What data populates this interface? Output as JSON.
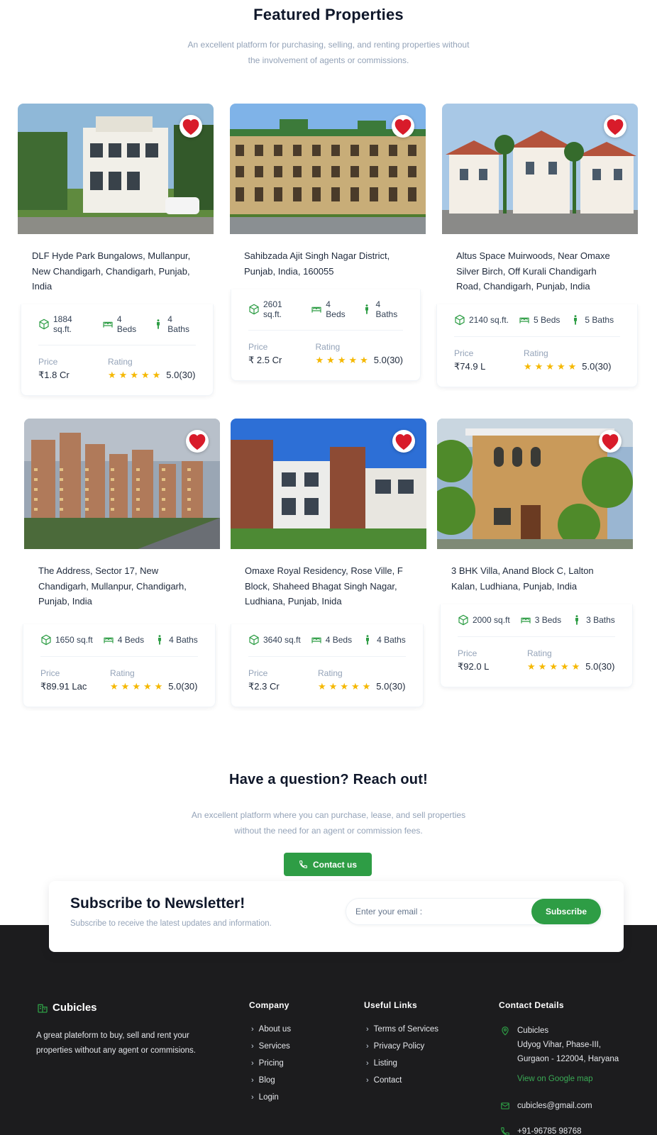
{
  "featured": {
    "title": "Featured Properties",
    "subtitle_line1": "An excellent platform for purchasing, selling, and renting properties without",
    "subtitle_line2": "the involvement of agents or commissions."
  },
  "labels": {
    "price": "Price",
    "rating": "Rating"
  },
  "properties": [
    {
      "address": "DLF Hyde Park Bungalows, Mullanpur, New Chandigarh, Chandigarh, Punjab, India",
      "area": "1884 sq.ft.",
      "beds": "4 Beds",
      "baths": "4 Baths",
      "price": "₹1.8 Cr",
      "stars": 5,
      "rating": "5.0(30)",
      "favorite": true,
      "image": "white-villa-photo"
    },
    {
      "address": "Sahibzada Ajit Singh Nagar District, Punjab, India, 160055",
      "area": "2601 sq.ft.",
      "beds": "4 Beds",
      "baths": "4 Baths",
      "price": "₹ 2.5 Cr",
      "stars": 5,
      "rating": "5.0(30)",
      "favorite": true,
      "image": "colonial-terrace-photo"
    },
    {
      "address": "Altus Space Muirwoods, Near Omaxe Silver Birch, Off Kurali Chandigarh Road, Chandigarh, Punjab, India",
      "area": "2140 sq.ft.",
      "beds": "5 Beds",
      "baths": "5 Baths",
      "price": "₹74.9 L",
      "stars": 5,
      "rating": "5.0(30)",
      "favorite": true,
      "image": "mediterranean-villas-photo"
    },
    {
      "address": "The Address, Sector 17, New Chandigarh, Mullanpur, Chandigarh, Punjab, India",
      "area": "1650 sq.ft",
      "beds": "4 Beds",
      "baths": "4 Baths",
      "price": "₹89.91 Lac",
      "stars": 5,
      "rating": "5.0(30)",
      "favorite": true,
      "image": "highrise-towers-photo"
    },
    {
      "address": "Omaxe Royal Residency, Rose Ville, F Block, Shaheed Bhagat Singh Nagar, Ludhiana, Punjab, Inida",
      "area": "3640 sq.ft",
      "beds": "4 Beds",
      "baths": "4 Baths",
      "price": "₹2.3 Cr",
      "stars": 5,
      "rating": "5.0(30)",
      "favorite": true,
      "image": "brick-floors-photo"
    },
    {
      "address": "3 BHK Villa, Anand Block C, Lalton Kalan, Ludhiana, Punjab, India",
      "area": "2000 sq.ft",
      "beds": "3 Beds",
      "baths": "3 Baths",
      "price": "₹92.0 L",
      "stars": 5,
      "rating": "5.0(30)",
      "favorite": true,
      "image": "tan-villa-photo"
    }
  ],
  "contact_section": {
    "title": "Have a question? Reach out!",
    "subtitle_line1": "An excellent platform where you can purchase, lease, and sell properties",
    "subtitle_line2": "without the need for an agent or commission fees.",
    "button": "Contact us"
  },
  "newsletter": {
    "title": "Subscribe to Newsletter!",
    "subtitle": "Subscribe to receive the latest updates and information.",
    "placeholder": "Enter your email :",
    "button": "Subscribe"
  },
  "footer": {
    "brand": "Cubicles",
    "about": "A great plateform to buy, sell and rent your properties without any agent or commisions.",
    "company": {
      "heading": "Company",
      "links": [
        "About us",
        "Services",
        "Pricing",
        "Blog",
        "Login"
      ]
    },
    "useful": {
      "heading": "Useful Links",
      "links": [
        "Terms of Services",
        "Privacy Policy",
        "Listing",
        "Contact"
      ]
    },
    "contact": {
      "heading": "Contact Details",
      "name": "Cubicles",
      "address_line1": "Udyog Vihar, Phase-III,",
      "address_line2": "Gurgaon - 122004, Haryana",
      "map_link": "View on Google map",
      "email": "cubicles@gmail.com",
      "phone": "+91-96785 98768"
    }
  },
  "colors": {
    "accent": "#2e9d45",
    "star": "#f5b800",
    "heart": "#d81b2a",
    "footer_bg": "#1c1c1e"
  }
}
